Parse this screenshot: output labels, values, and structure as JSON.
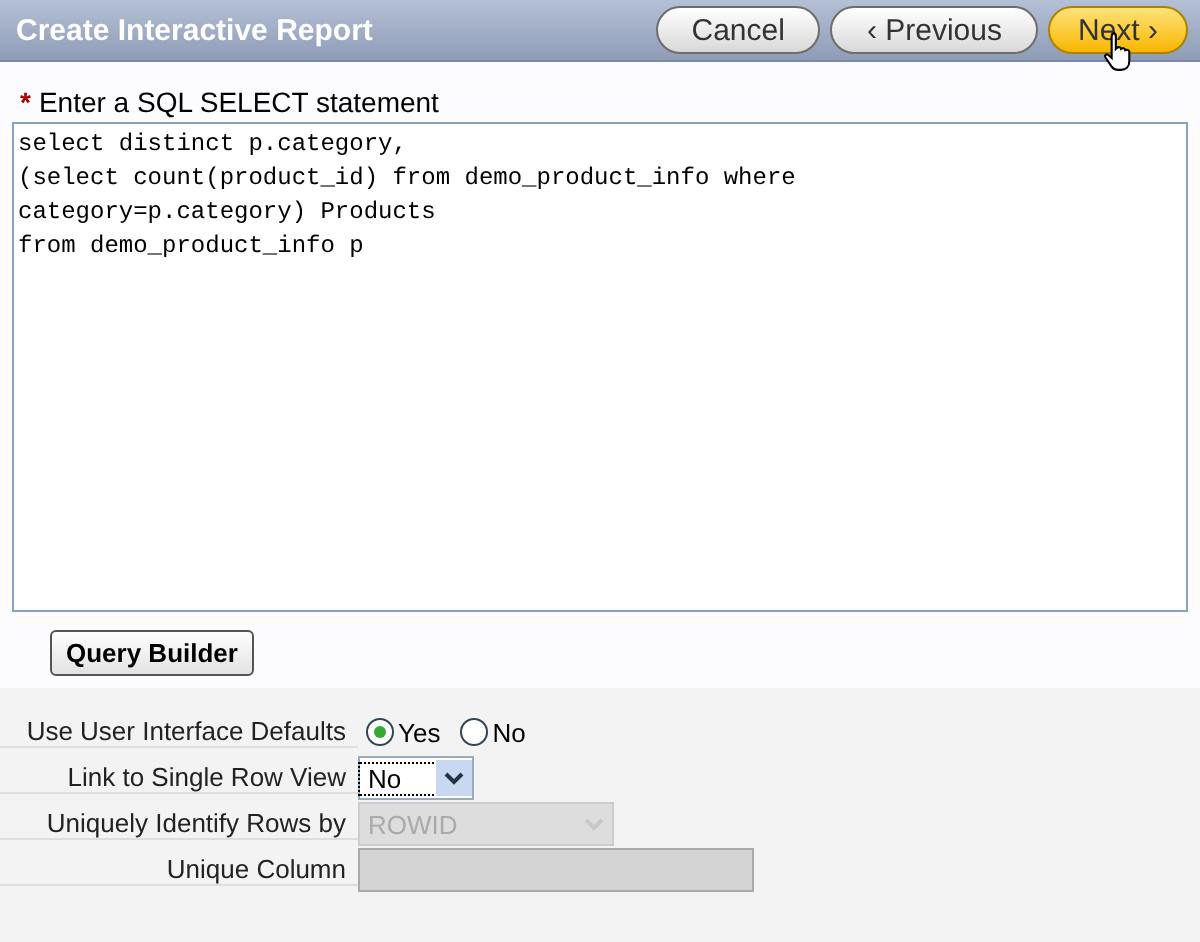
{
  "header": {
    "title": "Create Interactive Report",
    "buttons": [
      {
        "label": "Cancel",
        "kind": "normal"
      },
      {
        "label": "‹ Previous",
        "kind": "normal"
      },
      {
        "label": "Next ›",
        "kind": "primary"
      }
    ]
  },
  "query": {
    "label": "Enter a SQL SELECT statement",
    "required_mark": "*",
    "value": "select distinct p.category,\n(select count(product_id) from demo_product_info where\ncategory=p.category) Products\nfrom demo_product_info p"
  },
  "query_builder": {
    "label": "Query Builder"
  },
  "form": [
    {
      "kind": "radio",
      "label": "Use User Interface Defaults",
      "options": [
        {
          "label": "Yes",
          "selected": true
        },
        {
          "label": "No",
          "selected": false
        }
      ]
    },
    {
      "kind": "select",
      "label": "Link to Single Row View",
      "value": "No",
      "disabled": false
    },
    {
      "kind": "select",
      "label": "Uniquely Identify Rows by",
      "value": "ROWID",
      "disabled": true
    },
    {
      "kind": "text",
      "label": "Unique Column",
      "disabled": true
    }
  ]
}
